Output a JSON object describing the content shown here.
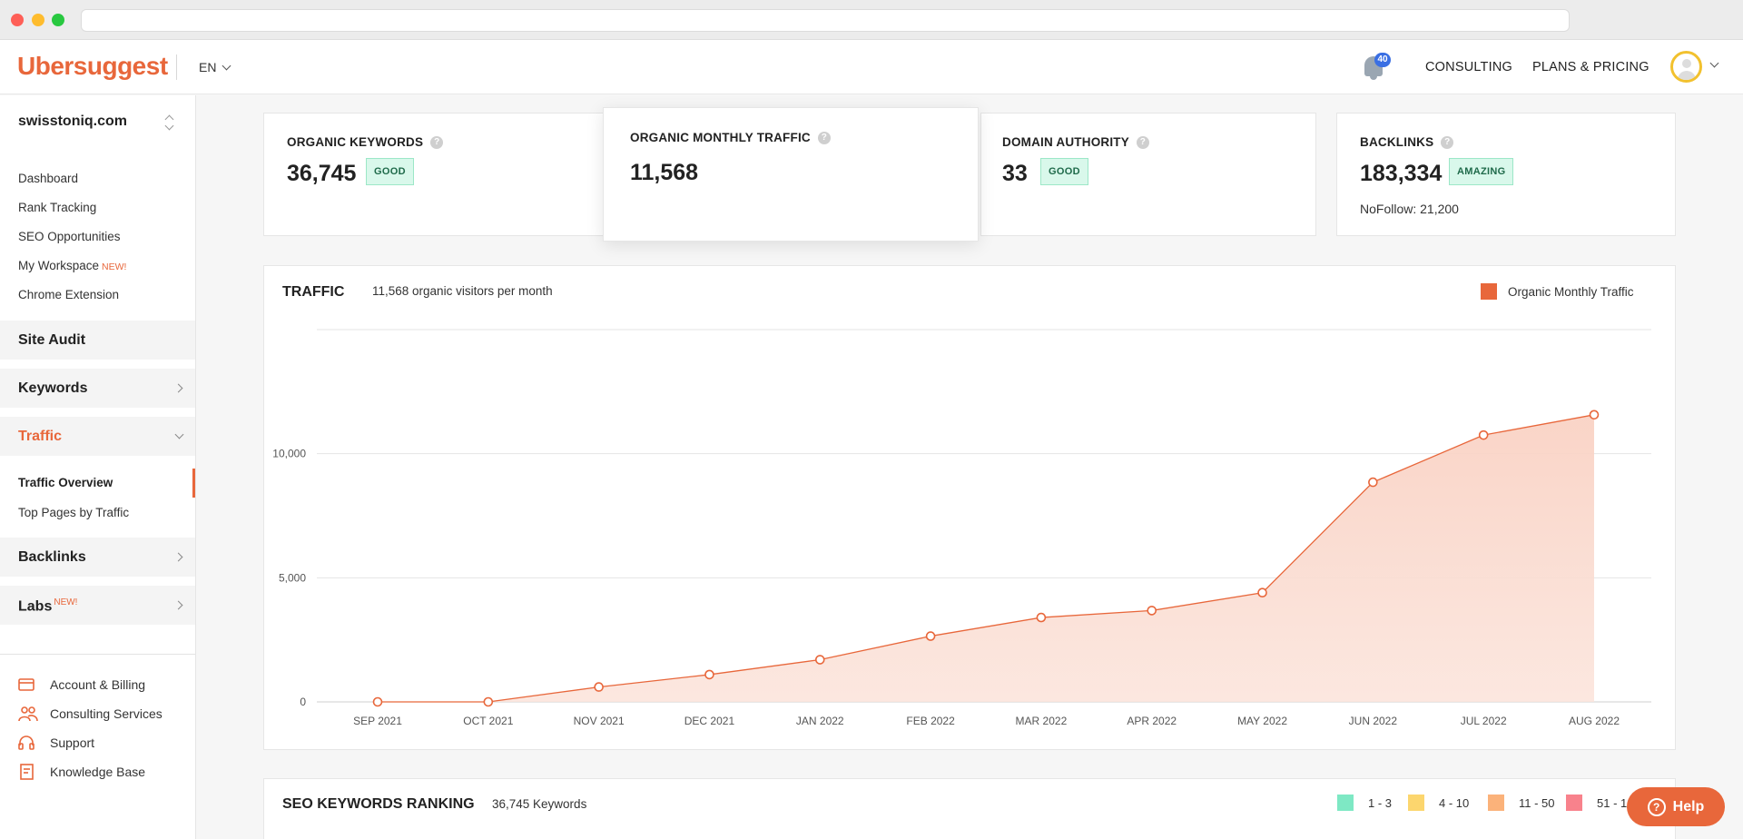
{
  "header": {
    "logo": "Ubersuggest",
    "language": "EN",
    "notifications_count": "40",
    "nav": [
      "CONSULTING",
      "PLANS & PRICING"
    ]
  },
  "sidebar": {
    "domain": "swisstoniq.com",
    "links": [
      {
        "label": "Dashboard"
      },
      {
        "label": "Rank Tracking"
      },
      {
        "label": "SEO Opportunities"
      },
      {
        "label": "My Workspace",
        "tag": "NEW!"
      },
      {
        "label": "Chrome Extension"
      }
    ],
    "sections": [
      {
        "label": "Site Audit"
      },
      {
        "label": "Keywords"
      },
      {
        "label": "Traffic"
      },
      {
        "label": "Backlinks"
      },
      {
        "label": "Labs",
        "tag": "NEW!"
      }
    ],
    "traffic_subitems": [
      "Traffic Overview",
      "Top Pages by Traffic"
    ],
    "footer": [
      {
        "label": "Account & Billing",
        "icon": "credit-card-icon"
      },
      {
        "label": "Consulting Services",
        "icon": "people-icon"
      },
      {
        "label": "Support",
        "icon": "headset-icon"
      },
      {
        "label": "Knowledge Base",
        "icon": "book-icon"
      }
    ]
  },
  "metrics": {
    "organic_keywords": {
      "title": "ORGANIC KEYWORDS",
      "value": "36,745",
      "badge": "GOOD"
    },
    "organic_traffic": {
      "title": "ORGANIC MONTHLY TRAFFIC",
      "value": "11,568"
    },
    "domain_authority": {
      "title": "DOMAIN AUTHORITY",
      "value": "33",
      "badge": "GOOD"
    },
    "backlinks": {
      "title": "BACKLINKS",
      "value": "183,334",
      "badge": "AMAZING",
      "nofollow": "NoFollow: 21,200"
    }
  },
  "traffic": {
    "title": "TRAFFIC",
    "subtitle": "11,568 organic visitors per month",
    "legend": "Organic Monthly Traffic"
  },
  "chart_data": {
    "type": "area",
    "title": "TRAFFIC",
    "categories": [
      "SEP 2021",
      "OCT 2021",
      "NOV 2021",
      "DEC 2021",
      "JAN 2022",
      "FEB 2022",
      "MAR 2022",
      "APR 2022",
      "MAY 2022",
      "JUN 2022",
      "JUL 2022",
      "AUG 2022"
    ],
    "series": [
      {
        "name": "Organic Monthly Traffic",
        "values": [
          0,
          0,
          600,
          1100,
          1700,
          2650,
          3400,
          3680,
          4400,
          8850,
          10750,
          11568
        ]
      }
    ],
    "yticks": [
      0,
      5000,
      10000
    ],
    "ytick_labels": [
      "0",
      "5,000",
      "10,000"
    ],
    "ylim": [
      0,
      15000
    ],
    "grid": true,
    "legend_position": "top-right",
    "color": "#e8673b"
  },
  "ranking": {
    "title": "SEO KEYWORDS RANKING",
    "subtitle": "36,745 Keywords",
    "legend": [
      {
        "label": "1 - 3",
        "color": "#7ee8c4"
      },
      {
        "label": "4 - 10",
        "color": "#fcd66e"
      },
      {
        "label": "11 - 50",
        "color": "#fbb27a"
      },
      {
        "label": "51 - 10",
        "color": "#f8828c"
      }
    ]
  },
  "help": {
    "label": "Help"
  }
}
